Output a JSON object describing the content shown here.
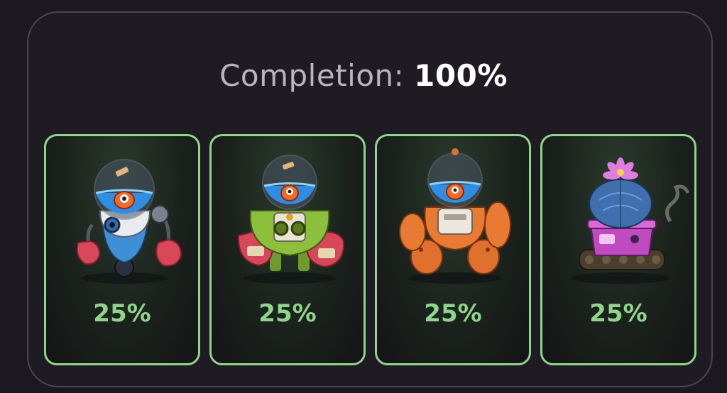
{
  "completion": {
    "label": "Completion:",
    "value": "100%"
  },
  "cards": [
    {
      "icon": "fish-robot-white-icon",
      "percent": "25%"
    },
    {
      "icon": "fish-robot-green-icon",
      "percent": "25%"
    },
    {
      "icon": "fish-robot-orange-icon",
      "percent": "25%"
    },
    {
      "icon": "cactus-tank-icon",
      "percent": "25%"
    }
  ],
  "colors": {
    "background": "#1c1820",
    "panel_border": "#4a4553",
    "card_border": "#8fd58a",
    "percent_text": "#8fd58a",
    "title_label": "#b9b5bf",
    "title_value": "#ffffff"
  }
}
